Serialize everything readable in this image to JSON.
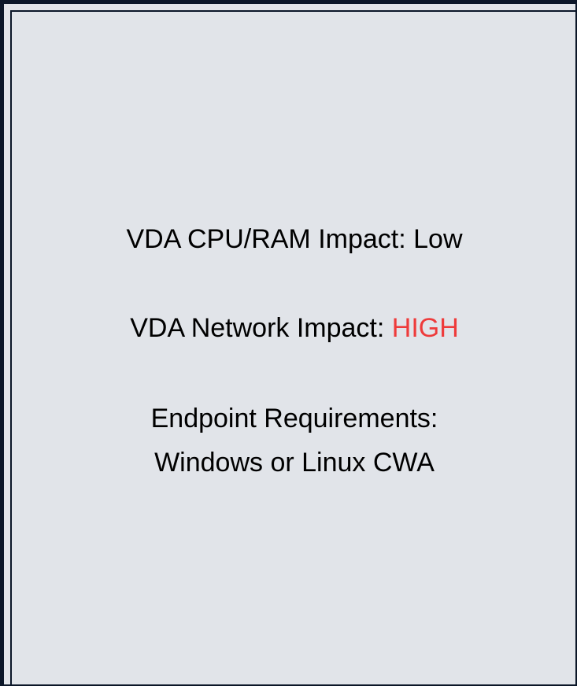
{
  "info_card": {
    "cpu_ram_label": "VDA CPU/RAM Impact: ",
    "cpu_ram_value": "Low",
    "network_label": "VDA Network Impact: ",
    "network_value": "HIGH",
    "endpoint_label": "Endpoint Requirements:",
    "endpoint_value": "Windows or Linux CWA"
  },
  "colors": {
    "background": "#e1e4e9",
    "border": "#0b1628",
    "text": "#000000",
    "high_accent": "#ee3b3b"
  }
}
